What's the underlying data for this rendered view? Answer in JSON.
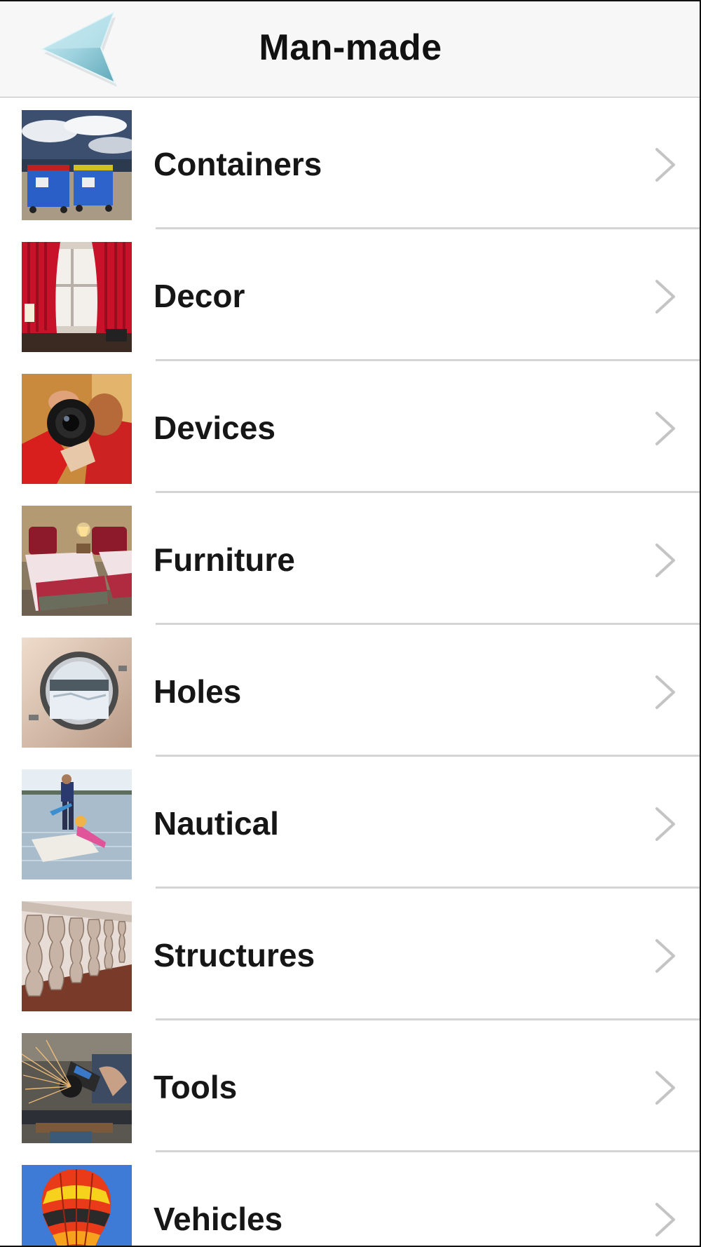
{
  "navbar": {
    "title": "Man-made",
    "back_icon": "back-arrow-icon",
    "accent_color": "#8fc9d6"
  },
  "list": {
    "items": [
      {
        "label": "Containers",
        "thumbnail": "trash-bins-photo"
      },
      {
        "label": "Decor",
        "thumbnail": "red-curtains-photo"
      },
      {
        "label": "Devices",
        "thumbnail": "camera-photo"
      },
      {
        "label": "Furniture",
        "thumbnail": "bedroom-photo"
      },
      {
        "label": "Holes",
        "thumbnail": "porthole-photo"
      },
      {
        "label": "Nautical",
        "thumbnail": "sailboat-photo"
      },
      {
        "label": "Structures",
        "thumbnail": "balustrade-photo"
      },
      {
        "label": "Tools",
        "thumbnail": "angle-grinder-photo"
      },
      {
        "label": "Vehicles",
        "thumbnail": "hot-air-balloon-photo"
      }
    ],
    "row_icon": "chevron-right-icon"
  }
}
